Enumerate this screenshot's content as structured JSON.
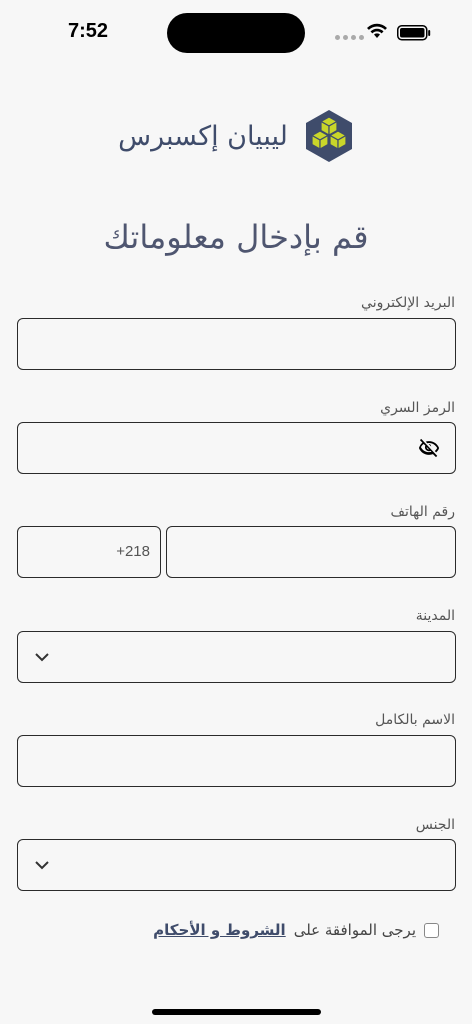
{
  "status": {
    "time": "7:52"
  },
  "brand": {
    "name": "ليبيان إكسبرس",
    "logo": "cube-logo-icon"
  },
  "title": "قم بإدخال معلوماتك",
  "form": {
    "email": {
      "label": "البريد الإلكتروني",
      "value": ""
    },
    "password": {
      "label": "الرمز السري",
      "value": "",
      "icon": "eye-off-icon"
    },
    "phone": {
      "label": "رقم الهاتف",
      "code": "+218",
      "value": ""
    },
    "city": {
      "label": "المدينة",
      "value": ""
    },
    "full_name": {
      "label": "الاسم بالكامل",
      "value": ""
    },
    "gender": {
      "label": "الجنس",
      "value": ""
    }
  },
  "terms": {
    "text": "يرجى الموافقة على",
    "link": "الشروط و الأحكام",
    "checked": false
  },
  "colors": {
    "brand": "#3f4c6b",
    "accent": "#c9d62a",
    "background": "#f7f7f7"
  }
}
